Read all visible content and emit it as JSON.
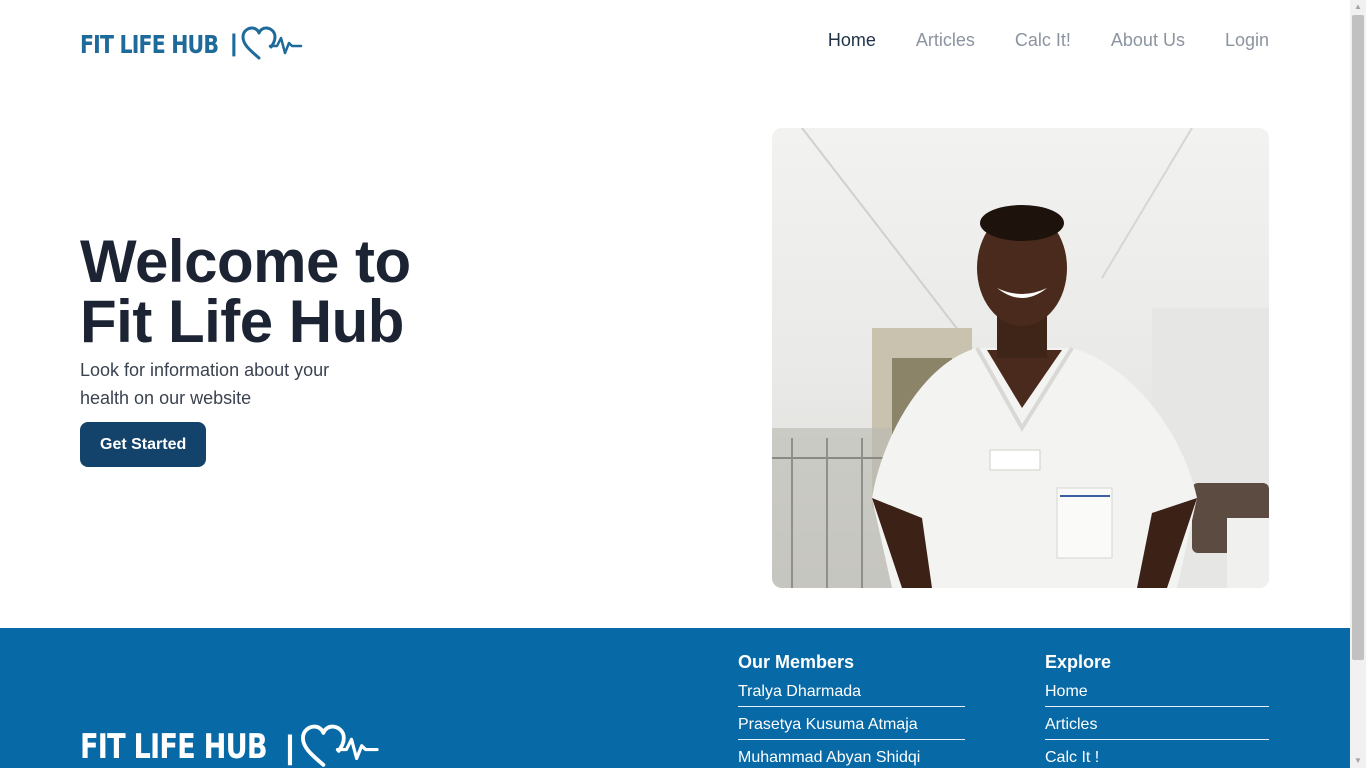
{
  "brand": {
    "logo_text": "FIT LIFE HUB",
    "separator": "|",
    "color": "#1e6a9a"
  },
  "nav": {
    "items": [
      {
        "label": "Home",
        "active": true
      },
      {
        "label": "Articles",
        "active": false
      },
      {
        "label": "Calc It!",
        "active": false
      },
      {
        "label": "About Us",
        "active": false
      },
      {
        "label": "Login",
        "active": false
      }
    ]
  },
  "hero": {
    "title_line1": "Welcome to",
    "title_line2": "Fit Life Hub",
    "subtitle": "Look for information about your health on our website",
    "cta_label": "Get Started",
    "cta_color": "#13436a",
    "image_icon": "smiling-nurse-photo"
  },
  "footer": {
    "background": "#0769a5",
    "members": {
      "heading": "Our Members",
      "items": [
        "Tralya Dharmada",
        "Prasetya Kusuma Atmaja",
        "Muhammad Abyan Shidqi"
      ]
    },
    "explore": {
      "heading": "Explore",
      "items": [
        "Home",
        "Articles",
        "Calc It !"
      ]
    }
  }
}
